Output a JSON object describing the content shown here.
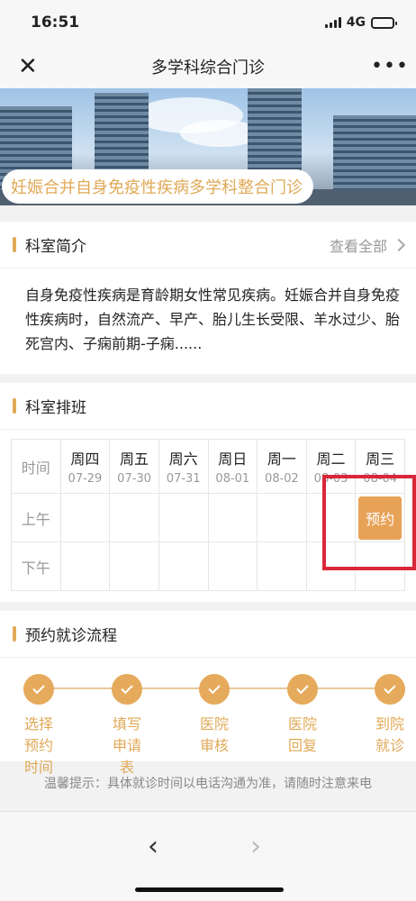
{
  "status_bar": {
    "time": "16:51",
    "network": "4G"
  },
  "nav": {
    "title": "多学科综合门诊",
    "more_label": "•••"
  },
  "banner": {
    "title": "妊娠合并自身免疫性疾病多学科整合门诊"
  },
  "intro": {
    "title": "科室简介",
    "view_all": "查看全部",
    "text": "自身免疫性疾病是育龄期女性常见疾病。妊娠合并自身免疫性疾病时，自然流产、早产、胎儿生长受限、羊水过少、胎死宫内、子痫前期-子痫......"
  },
  "schedule": {
    "title": "科室排班",
    "time_label": "时间",
    "rows": [
      "上午",
      "下午"
    ],
    "days": [
      {
        "name": "周四",
        "date": "07-29"
      },
      {
        "name": "周五",
        "date": "07-30"
      },
      {
        "name": "周六",
        "date": "07-31"
      },
      {
        "name": "周日",
        "date": "08-01"
      },
      {
        "name": "周一",
        "date": "08-02"
      },
      {
        "name": "周二",
        "date": "08-03"
      },
      {
        "name": "周三",
        "date": "08-04"
      }
    ],
    "book_label": "预约"
  },
  "process": {
    "title": "预约就诊流程",
    "steps": [
      "选择预约时间",
      "填写申请表",
      "医院审核",
      "医院回复",
      "到院就诊"
    ]
  },
  "tip": "温馨提示：具体就诊时间以电话沟通为准，请随时注意来电",
  "colors": {
    "accent": "#e0a957",
    "button": "#e8a258",
    "highlight": "#d9273a"
  }
}
